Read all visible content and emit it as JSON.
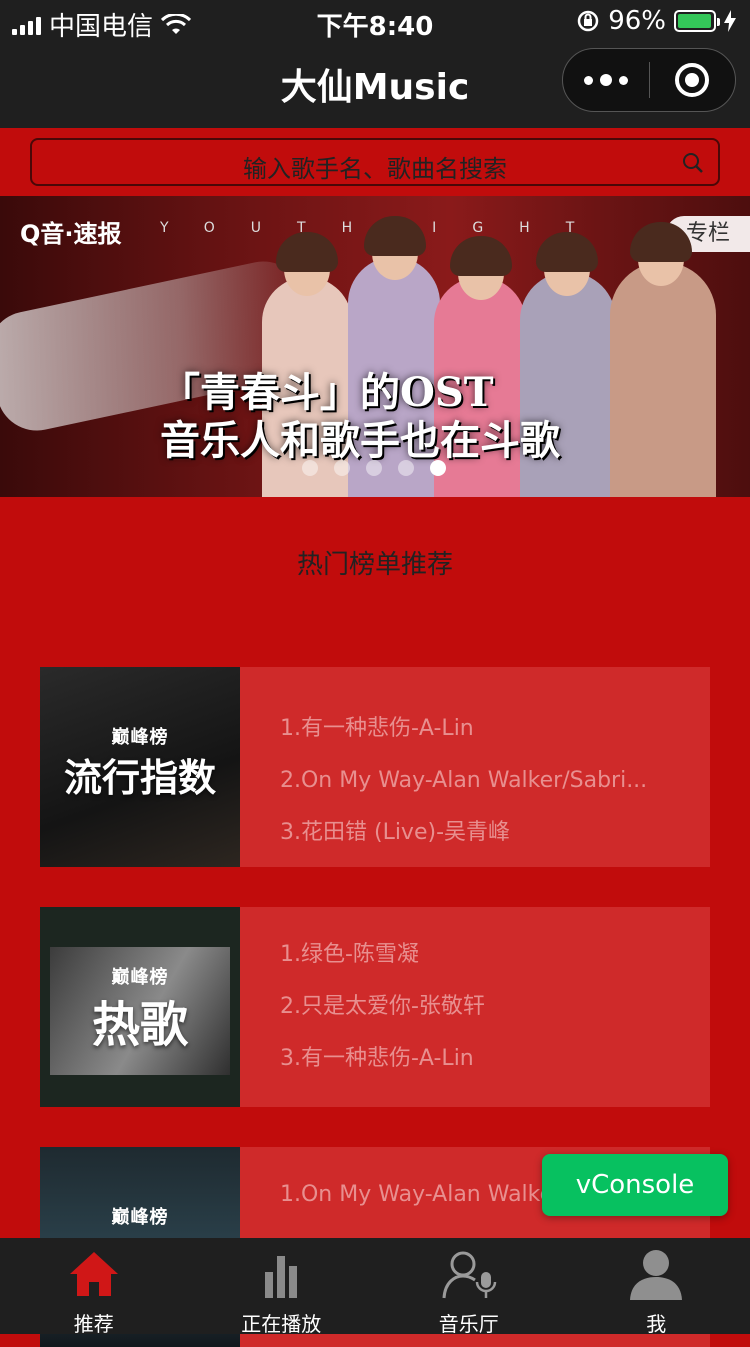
{
  "status_bar": {
    "carrier": "中国电信",
    "time": "下午8:40",
    "battery": "96%",
    "battery_level": 0.96
  },
  "navbar": {
    "title": "大仙Music"
  },
  "search": {
    "placeholder": "输入歌手名、歌曲名搜索"
  },
  "banner": {
    "brand": "Q音·速报",
    "youth_text": "YOUTHFIGHT",
    "column_tag": "专栏",
    "headline_1": "「青春斗」的OST",
    "headline_2": "音乐人和歌手也在斗歌",
    "dots_total": 5,
    "active_dot": 5
  },
  "section_title": "热门榜单推荐",
  "rankings": [
    {
      "logo_text": "巅峰榜",
      "cover_title": "流行指数",
      "songs": [
        "1.有一种悲伤-A-Lin",
        "2.On My Way-Alan Walker/Sabri...",
        "3.花田错 (Live)-吴青峰"
      ]
    },
    {
      "logo_text": "巅峰榜",
      "cover_title": "热歌",
      "songs": [
        "1.绿色-陈雪凝",
        "2.只是太爱你-张敬轩",
        "3.有一种悲伤-A-Lin"
      ]
    },
    {
      "logo_text": "巅峰榜",
      "cover_title": "",
      "songs": [
        "1.On My Way-Alan Walker/Sabri..."
      ]
    }
  ],
  "vconsole_label": "vConsole",
  "tabs": [
    {
      "label": "推荐",
      "icon": "home-icon",
      "active": true
    },
    {
      "label": "正在播放",
      "icon": "bars-icon",
      "active": false
    },
    {
      "label": "音乐厅",
      "icon": "singer-mic-icon",
      "active": false
    },
    {
      "label": "我",
      "icon": "user-icon",
      "active": false
    }
  ],
  "colors": {
    "theme_red": "#c10c0c",
    "card_red": "#cf2a2a",
    "dark": "#1f1f1f",
    "vconsole_green": "#07c160"
  }
}
